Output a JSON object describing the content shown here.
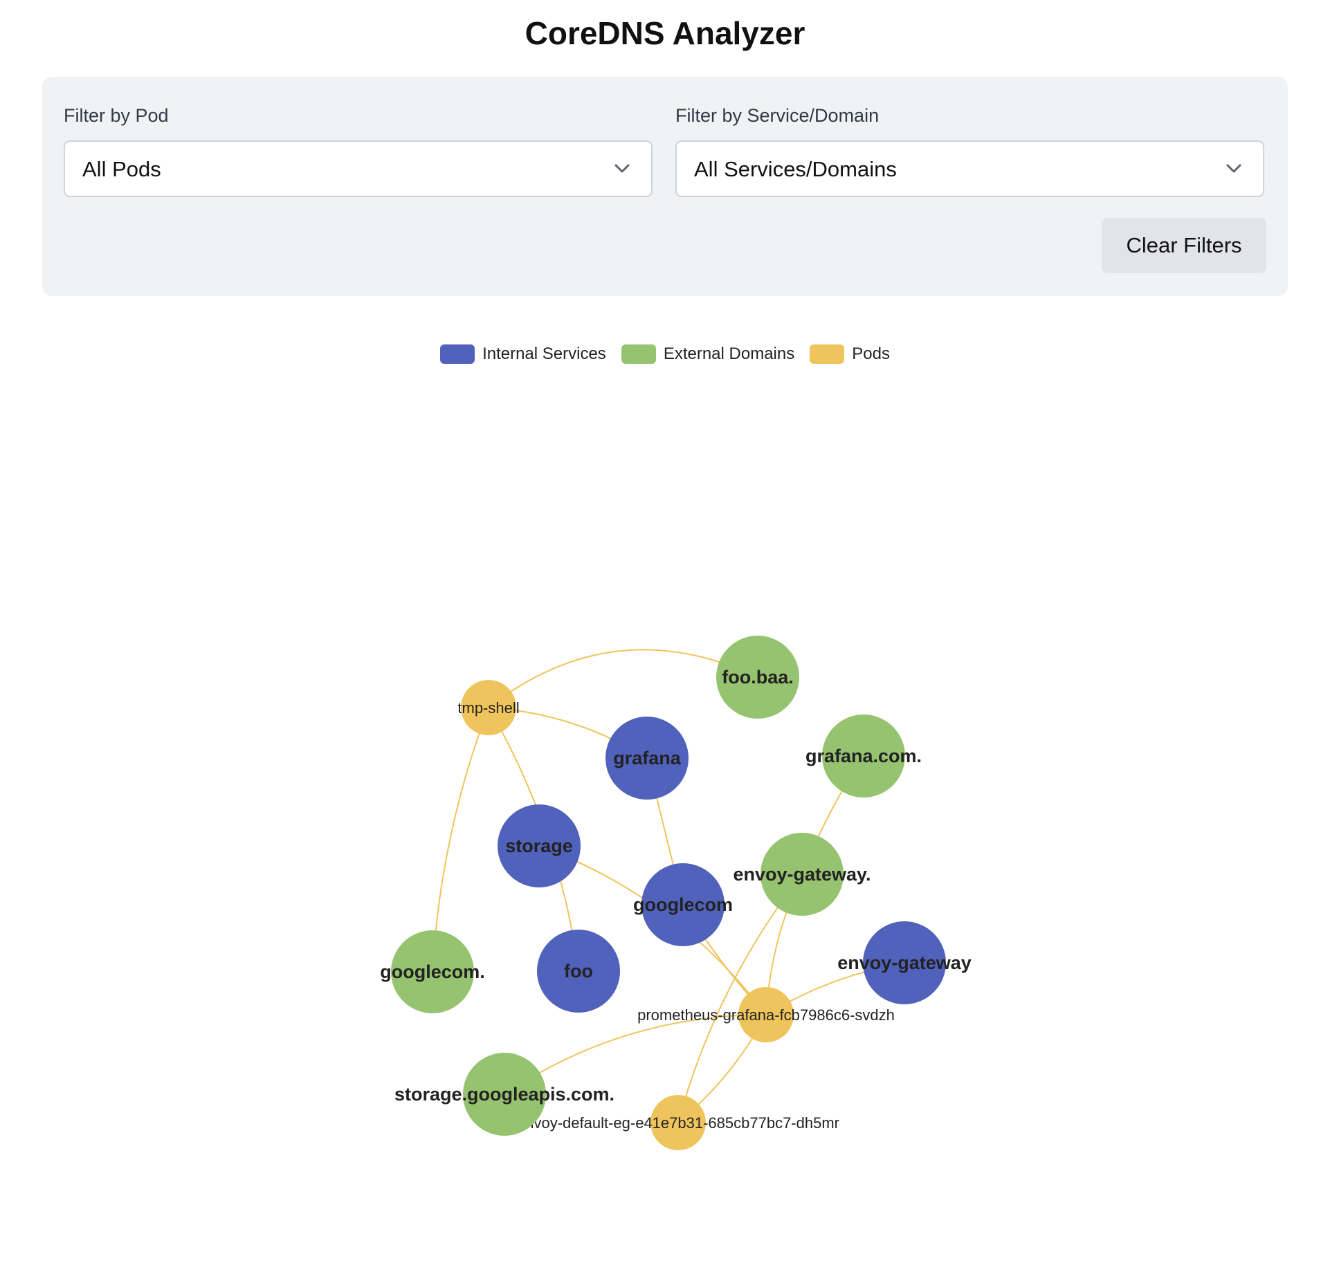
{
  "header": {
    "title": "CoreDNS Analyzer"
  },
  "filters": {
    "pod": {
      "label": "Filter by Pod",
      "selected": "All Pods"
    },
    "service": {
      "label": "Filter by Service/Domain",
      "selected": "All Services/Domains"
    },
    "clear_label": "Clear Filters"
  },
  "legend": {
    "items": [
      {
        "label": "Internal Services",
        "color": "#5062bb"
      },
      {
        "label": "External Domains",
        "color": "#96c36f"
      },
      {
        "label": "Pods",
        "color": "#f0c45c"
      }
    ]
  },
  "graph": {
    "edge_color": "#f0c45c",
    "nodes": [
      {
        "id": "tmp-shell",
        "label": "tmp-shell",
        "kind": "pod"
      },
      {
        "id": "prometheus-grafana-fcb7986c6-svdzh",
        "label": "prometheus-grafana-fcb7986c6-svdzh",
        "kind": "pod"
      },
      {
        "id": "envoy-default-eg-e41e7b31-685cb77bc7-dh5mr",
        "label": "envoy-default-eg-e41e7b31-685cb77bc7-dh5mr",
        "kind": "pod"
      },
      {
        "id": "foo.baa.",
        "label": "foo.baa.",
        "kind": "external"
      },
      {
        "id": "grafana.com.",
        "label": "grafana.com.",
        "kind": "external"
      },
      {
        "id": "envoy-gateway.",
        "label": "envoy-gateway.",
        "kind": "external"
      },
      {
        "id": "googlecom.",
        "label": "googlecom.",
        "kind": "external"
      },
      {
        "id": "storage.googleapis.com.",
        "label": "storage.googleapis.com.",
        "kind": "external"
      },
      {
        "id": "grafana",
        "label": "grafana",
        "kind": "internal"
      },
      {
        "id": "storage",
        "label": "storage",
        "kind": "internal"
      },
      {
        "id": "googlecom",
        "label": "googlecom",
        "kind": "internal"
      },
      {
        "id": "foo",
        "label": "foo",
        "kind": "internal"
      },
      {
        "id": "envoy-gateway",
        "label": "envoy-gateway",
        "kind": "internal"
      }
    ],
    "edges": [
      {
        "source": "tmp-shell",
        "target": "foo.baa."
      },
      {
        "source": "tmp-shell",
        "target": "grafana"
      },
      {
        "source": "tmp-shell",
        "target": "foo"
      },
      {
        "source": "tmp-shell",
        "target": "googlecom."
      },
      {
        "source": "grafana",
        "target": "googlecom"
      },
      {
        "source": "storage",
        "target": "prometheus-grafana-fcb7986c6-svdzh"
      },
      {
        "source": "googlecom",
        "target": "prometheus-grafana-fcb7986c6-svdzh"
      },
      {
        "source": "grafana.com.",
        "target": "envoy-gateway."
      },
      {
        "source": "envoy-gateway.",
        "target": "prometheus-grafana-fcb7986c6-svdzh"
      },
      {
        "source": "envoy-gateway.",
        "target": "envoy-default-eg-e41e7b31-685cb77bc7-dh5mr"
      },
      {
        "source": "envoy-gateway",
        "target": "prometheus-grafana-fcb7986c6-svdzh"
      },
      {
        "source": "prometheus-grafana-fcb7986c6-svdzh",
        "target": "storage.googleapis.com."
      },
      {
        "source": "prometheus-grafana-fcb7986c6-svdzh",
        "target": "envoy-default-eg-e41e7b31-685cb77bc7-dh5mr"
      }
    ]
  }
}
